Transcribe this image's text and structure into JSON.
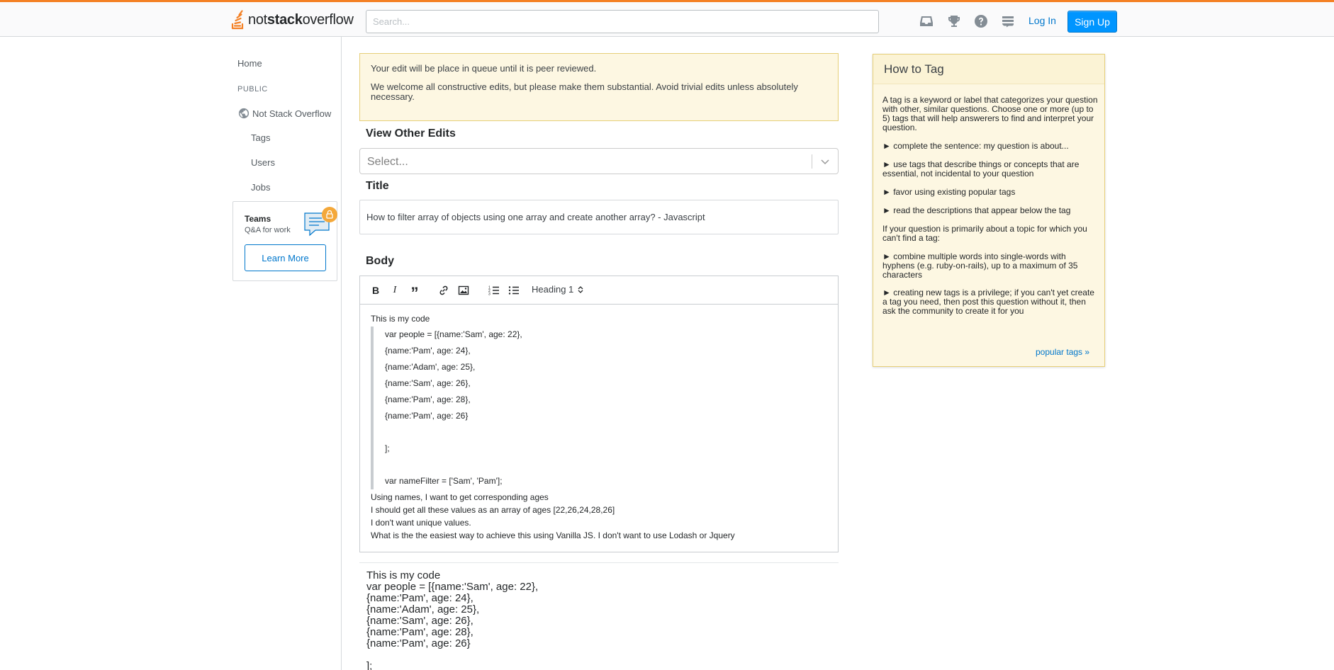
{
  "header": {
    "logo_prefix": "not",
    "logo_bold": "stack",
    "logo_suffix": "overflow",
    "search_placeholder": "Search...",
    "icons": [
      "inbox-icon",
      "trophy-icon",
      "help-icon",
      "stack-exchange-icon"
    ],
    "login_label": "Log In",
    "signup_label": "Sign Up",
    "accent_color": "#f48024"
  },
  "sidebar": {
    "home": "Home",
    "public_heading": "PUBLIC",
    "site_name": "Not Stack Overflow",
    "tags": "Tags",
    "users": "Users",
    "jobs": "Jobs",
    "teams_title": "Teams",
    "teams_subtitle": "Q&A for work",
    "learn_more": "Learn More"
  },
  "notice": {
    "line1": "Your edit will be place in queue until it is peer reviewed.",
    "line2": "We welcome all constructive edits, but please make them substantial. Avoid trivial edits unless absolutely necessary."
  },
  "view_other_edits": {
    "label": "View Other Edits",
    "select_placeholder": "Select..."
  },
  "title_field": {
    "label": "Title",
    "value": "How to filter array of objects using one array and create another array? - Javascript"
  },
  "body_field": {
    "label": "Body",
    "toolbar": {
      "bold": "B",
      "italic": "I",
      "quote": "”",
      "heading": "Heading 1"
    },
    "intro": "This is my code",
    "quote_lines": [
      "var people = [{name:'Sam', age: 22},",
      "{name:'Pam', age: 24},",
      "{name:'Adam', age: 25},",
      "{name:'Sam', age: 26},",
      "{name:'Pam', age: 28},",
      "{name:'Pam', age: 26}",
      "",
      "];",
      "",
      "var nameFilter = ['Sam', 'Pam'];"
    ],
    "after_lines": [
      "Using names, I want to get corresponding ages",
      "I should get all these values as an array of ages [22,26,24,28,26]",
      "I don't want unique values.",
      "What is the the easiest way to achieve this using Vanilla JS. I don't want to use Lodash or Jquery"
    ]
  },
  "preview": {
    "lines": [
      "This is my code",
      "var people = [{name:'Sam', age: 22},",
      "{name:'Pam', age: 24},",
      "{name:'Adam', age: 25},",
      "{name:'Sam', age: 26},",
      "{name:'Pam', age: 28},",
      "{name:'Pam', age: 26}",
      "",
      "];"
    ]
  },
  "how_to_tag": {
    "title": "How to Tag",
    "intro": "A tag is a keyword or label that categorizes your question with other, similar questions. Choose one or more (up to 5) tags that will help answerers to find and interpret your question.",
    "bullets_1": [
      "► complete the sentence: my question is about...",
      "► use tags that describe things or concepts that are essential, not incidental to your question",
      "► favor using existing popular tags",
      "► read the descriptions that appear below the tag"
    ],
    "missing_intro": "If your question is primarily about a topic for which you can't find a tag:",
    "bullets_2": [
      "► combine multiple words into single-words with hyphens (e.g. ruby-on-rails), up to a maximum of 35 characters",
      "► creating new tags is a privilege; if you can't yet create a tag you need, then post this question without it, then ask the community to create it for you"
    ],
    "popular_link": "popular tags »"
  }
}
